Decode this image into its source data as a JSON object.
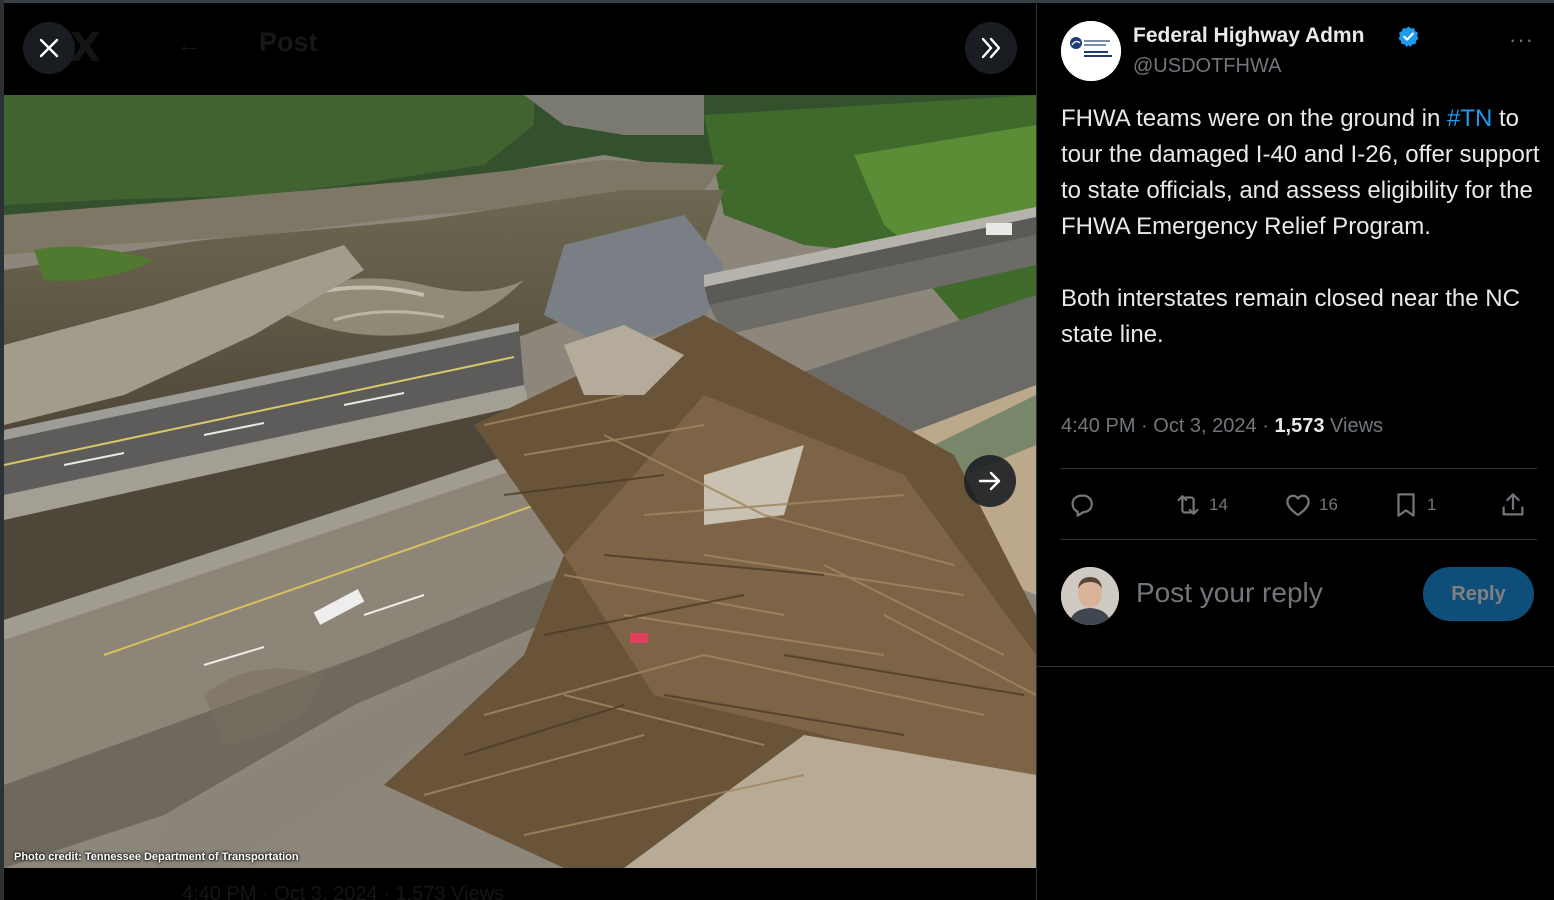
{
  "media_viewer": {
    "background_header": {
      "logo": "X",
      "back_icon": "←",
      "title": "Post"
    },
    "background_footer": "4:40 PM · Oct 3, 2024 · 1,573 Views",
    "photo_credit": "Photo credit: Tennessee Department of Transportation",
    "icons": {
      "close": "close-icon",
      "expand": "double-chevron-right-icon",
      "next": "arrow-right-icon"
    }
  },
  "post": {
    "author": {
      "display_name": "Federal Highway Admn",
      "handle": "@USDOTFHWA",
      "verified": true,
      "avatar_logo_text": "U.S. Department of Transportation Federal Highway Administration"
    },
    "text_part1": "FHWA teams were on the ground in ",
    "hashtag": "#TN",
    "text_part2": " to tour the damaged I-40 and I-26, offer support to state officials, and assess eligibility for the FHWA Emergency Relief Program.",
    "text_paragraph2": "Both interstates remain closed near the NC state line.",
    "timestamp": "4:40 PM · Oct 3, 2024 · ",
    "views_count": "1,573",
    "views_label": " Views",
    "actions": {
      "reply": {
        "icon": "reply-icon",
        "count": ""
      },
      "repost": {
        "icon": "repost-icon",
        "count": "14"
      },
      "like": {
        "icon": "heart-icon",
        "count": "16"
      },
      "bookmark": {
        "icon": "bookmark-icon",
        "count": "1"
      },
      "share": {
        "icon": "share-icon",
        "count": ""
      }
    },
    "more_icon": "···"
  },
  "reply_composer": {
    "placeholder": "Post your reply",
    "button_label": "Reply"
  },
  "colors": {
    "background": "#000000",
    "text_primary": "#e7e9ea",
    "text_secondary": "#71767b",
    "accent": "#1d9bf0",
    "reply_button_disabled": "#0f4e78"
  }
}
